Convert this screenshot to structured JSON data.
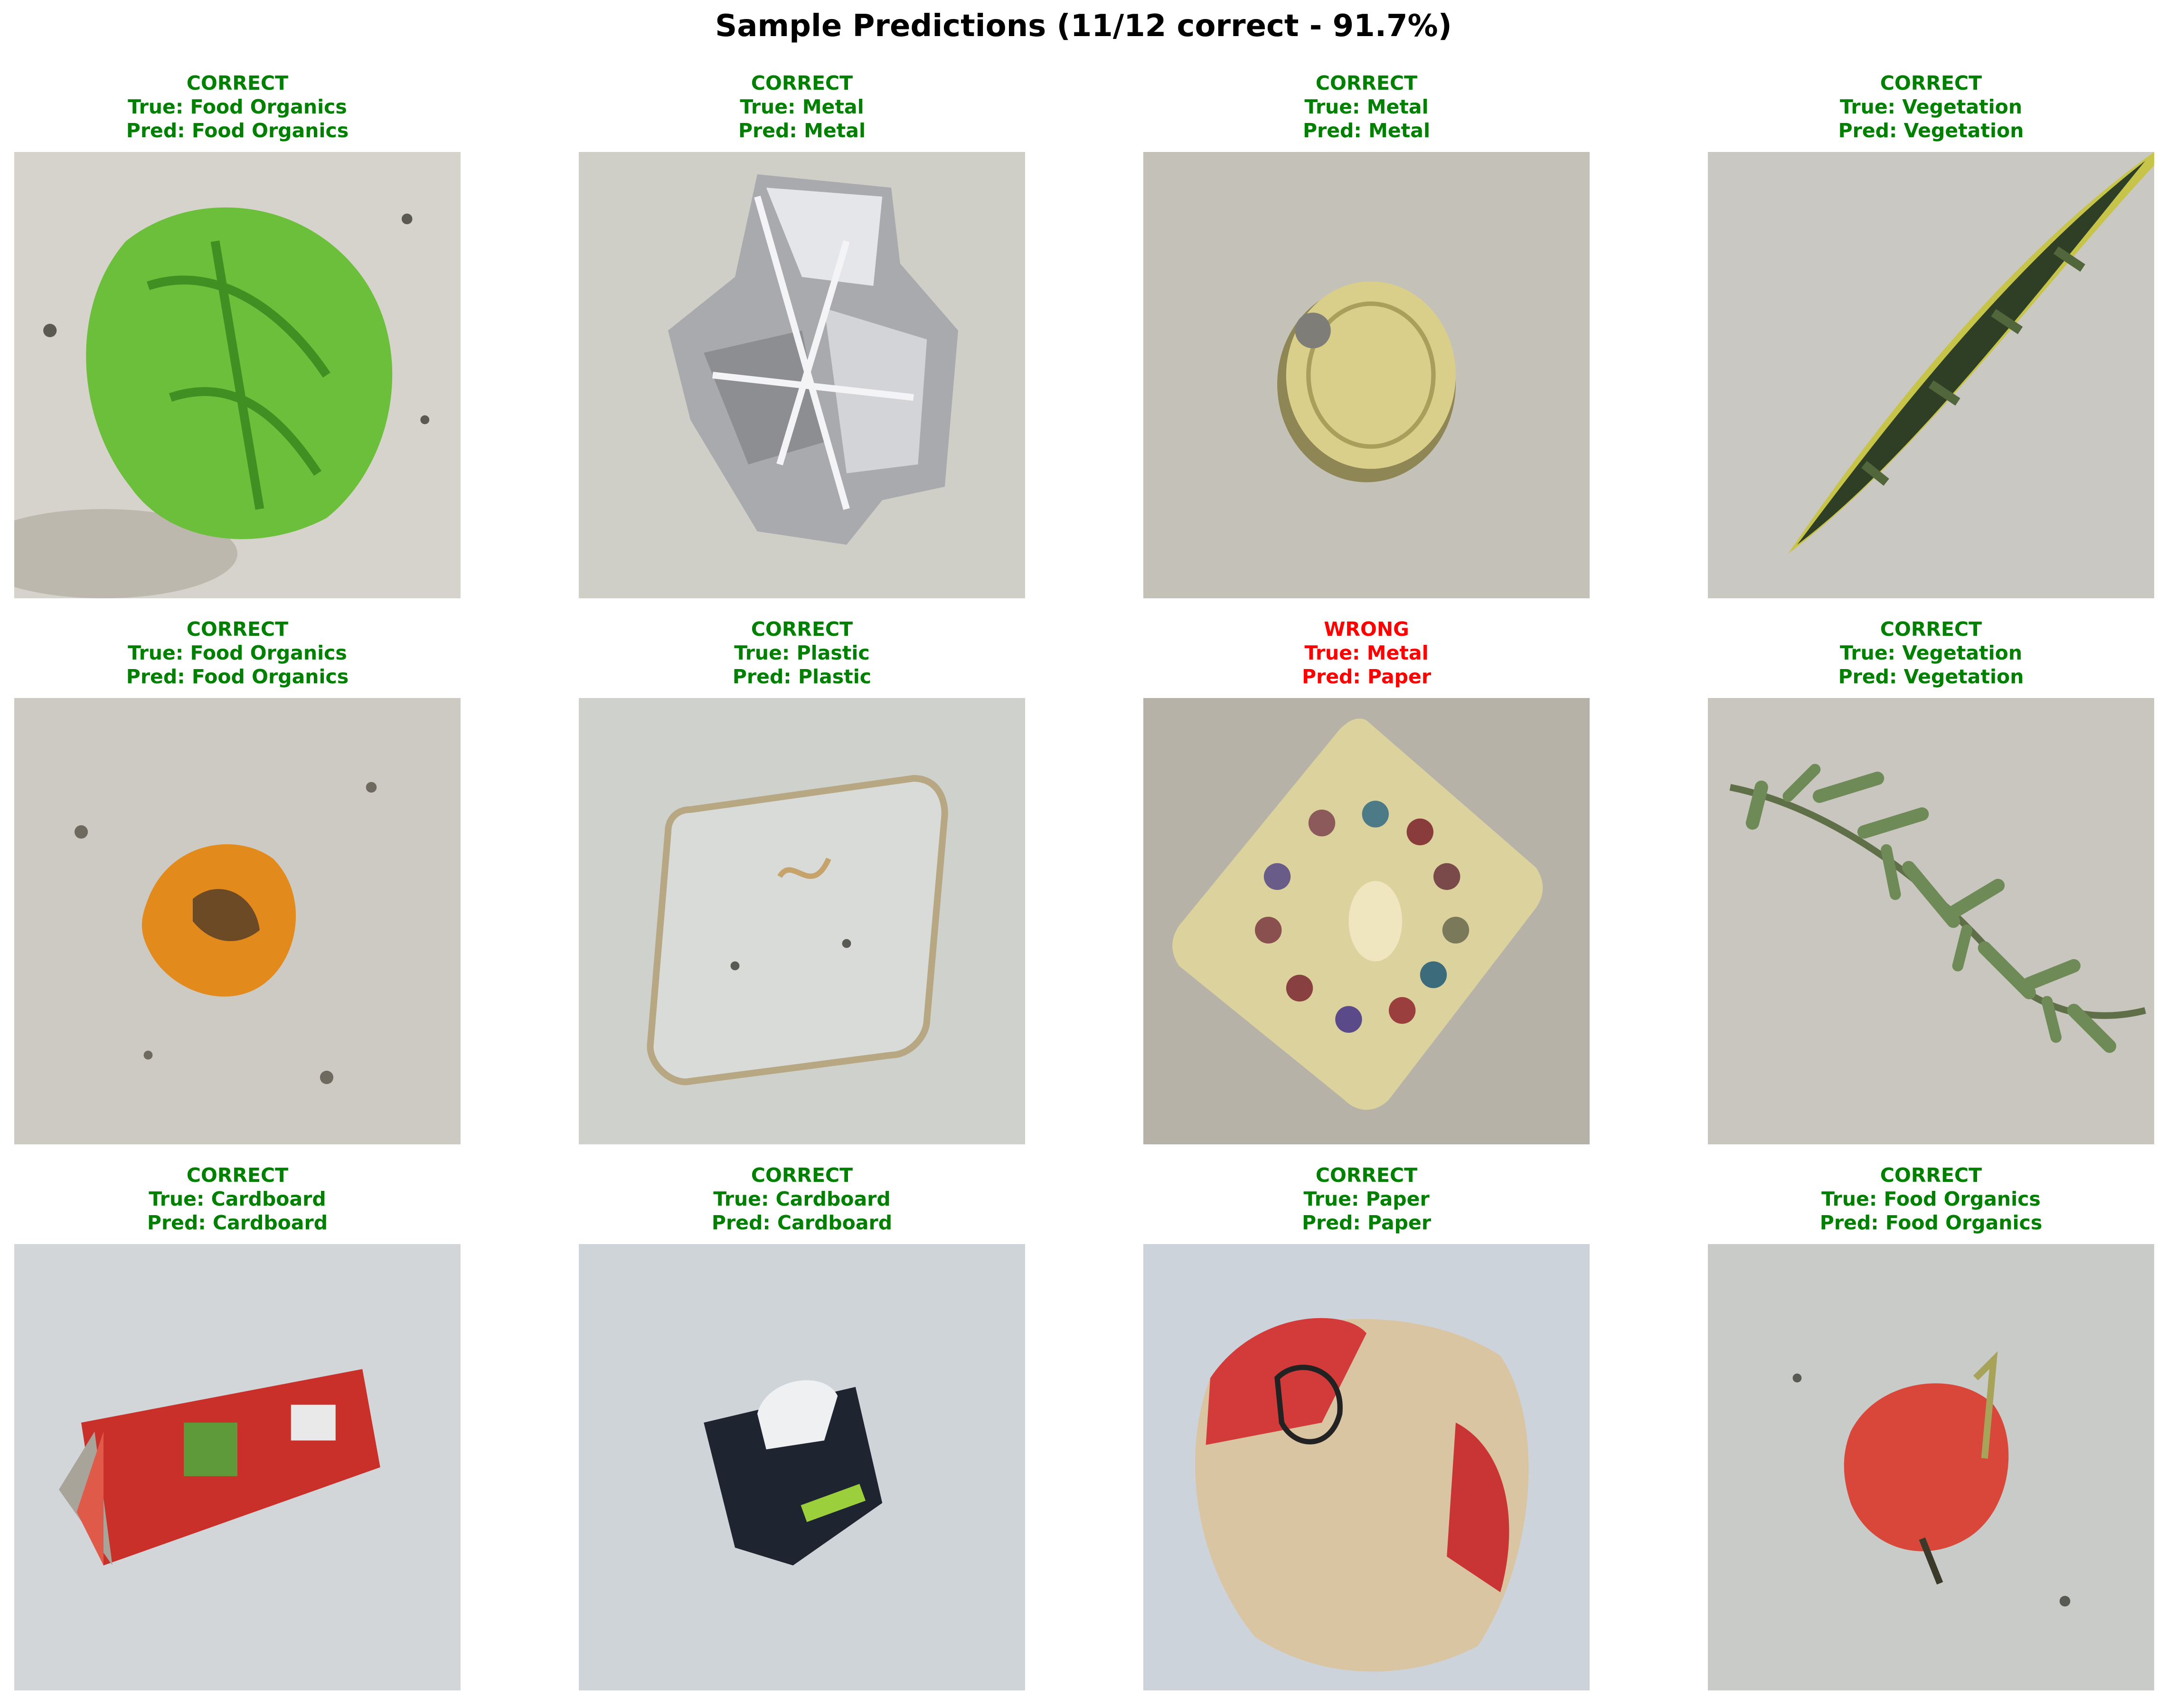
{
  "title": "Sample Predictions (11/12 correct - 91.7%)",
  "colors": {
    "correct": "#008000",
    "wrong": "#ff0000"
  },
  "samples": [
    {
      "status": "CORRECT",
      "true_line": "True: Food Organics",
      "pred_line": "Pred: Food Organics",
      "image": "lettuce-leaf-icon"
    },
    {
      "status": "CORRECT",
      "true_line": "True: Metal",
      "pred_line": "Pred: Metal",
      "image": "crumpled-foil-icon"
    },
    {
      "status": "CORRECT",
      "true_line": "True: Metal",
      "pred_line": "Pred: Metal",
      "image": "can-lid-icon"
    },
    {
      "status": "CORRECT",
      "true_line": "True: Vegetation",
      "pred_line": "Pred: Vegetation",
      "image": "snake-plant-leaf-icon"
    },
    {
      "status": "CORRECT",
      "true_line": "True: Food Organics",
      "pred_line": "Pred: Food Organics",
      "image": "orange-peel-icon"
    },
    {
      "status": "CORRECT",
      "true_line": "True: Plastic",
      "pred_line": "Pred: Plastic",
      "image": "plastic-tray-icon"
    },
    {
      "status": "WRONG",
      "true_line": "True: Metal",
      "pred_line": "Pred: Paper",
      "image": "chocolate-tray-icon"
    },
    {
      "status": "CORRECT",
      "true_line": "True: Vegetation",
      "pred_line": "Pred: Vegetation",
      "image": "herb-sprig-icon"
    },
    {
      "status": "CORRECT",
      "true_line": "True: Cardboard",
      "pred_line": "Pred: Cardboard",
      "image": "red-box-icon"
    },
    {
      "status": "CORRECT",
      "true_line": "True: Cardboard",
      "pred_line": "Pred: Cardboard",
      "image": "dark-box-icon"
    },
    {
      "status": "CORRECT",
      "true_line": "True: Paper",
      "pred_line": "Pred: Paper",
      "image": "crumpled-paper-bag-icon"
    },
    {
      "status": "CORRECT",
      "true_line": "True: Food Organics",
      "pred_line": "Pred: Food Organics",
      "image": "tomato-icon"
    }
  ]
}
